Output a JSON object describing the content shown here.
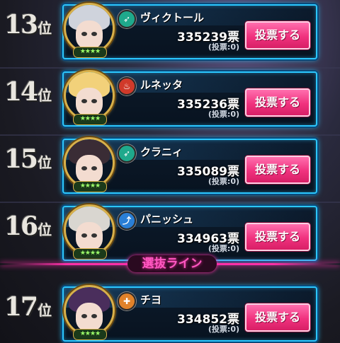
{
  "ranking": [
    {
      "rank": "13",
      "rank_suffix": "位",
      "name": "ヴィクトール",
      "votes": "335239票",
      "my_votes": "(投票:0)",
      "button": "投票する",
      "element_icon": "wind-icon",
      "element_color": "#1fa98c",
      "hair_color": "#cfd3dc",
      "stars": "★★★★"
    },
    {
      "rank": "14",
      "rank_suffix": "位",
      "name": "ルネッタ",
      "votes": "335236票",
      "my_votes": "(投票:0)",
      "button": "投票する",
      "element_icon": "fire-icon",
      "element_color": "#d03a2a",
      "hair_color": "#f2d17a",
      "stars": "★★★★"
    },
    {
      "rank": "15",
      "rank_suffix": "位",
      "name": "クラニィ",
      "votes": "335089票",
      "my_votes": "(投票:0)",
      "button": "投票する",
      "element_icon": "wind-icon",
      "element_color": "#1fa98c",
      "hair_color": "#3a2c35",
      "stars": "★★★★"
    },
    {
      "rank": "16",
      "rank_suffix": "位",
      "name": "パニッシュ",
      "votes": "334963票",
      "my_votes": "(投票:0)",
      "button": "投票する",
      "element_icon": "water-icon",
      "element_color": "#2a7fd6",
      "hair_color": "#d9d6d0",
      "stars": "★★★★"
    },
    {
      "rank": "17",
      "rank_suffix": "位",
      "name": "チヨ",
      "votes": "334852票",
      "my_votes": "(投票:0)",
      "button": "投票する",
      "element_icon": "earth-icon",
      "element_color": "#e0822a",
      "hair_color": "#4a2e5c",
      "stars": "★★★★"
    }
  ],
  "selection_line_label": "選抜ライン"
}
